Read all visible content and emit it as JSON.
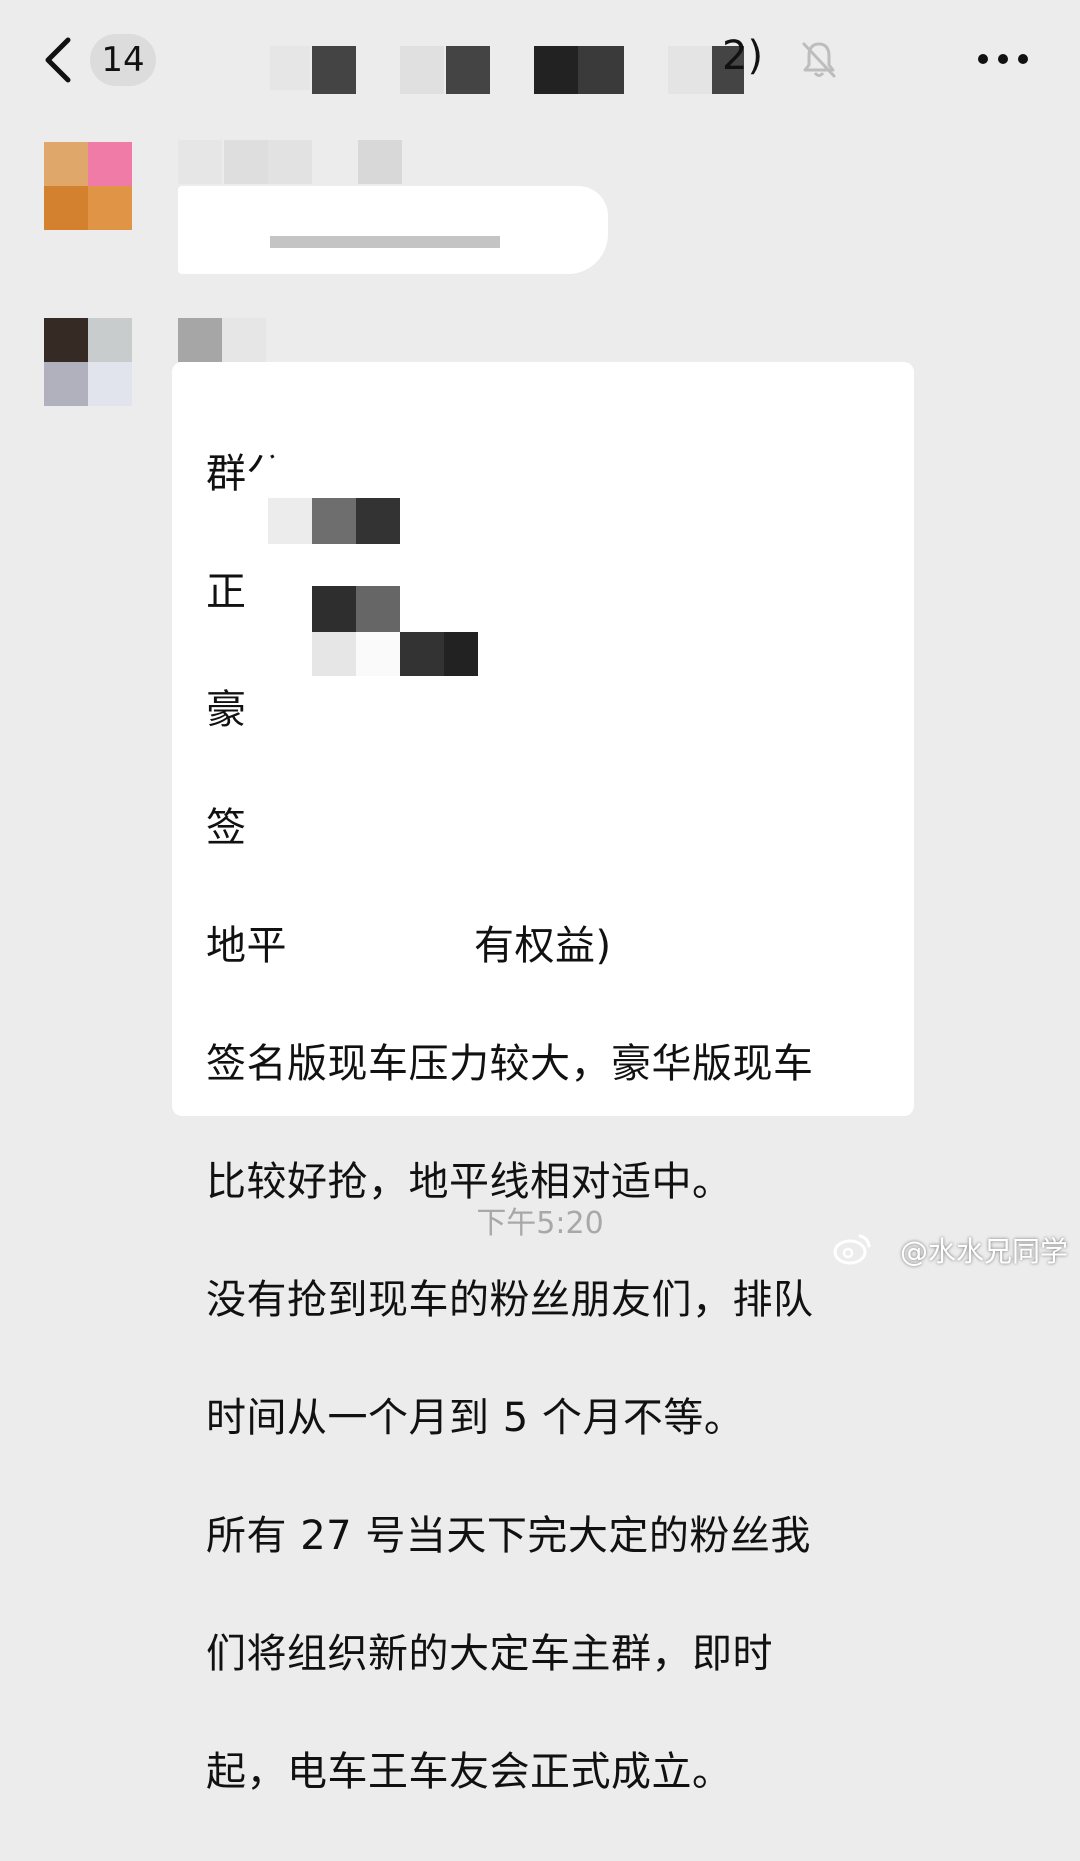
{
  "header": {
    "unread_count": "14",
    "title_visible_tail": "2)",
    "icons": [
      "back-arrow-icon",
      "mute-bell-icon",
      "more-icon"
    ]
  },
  "messages": [
    {
      "type": "blurred",
      "sender": "redacted"
    },
    {
      "type": "announcement",
      "sender": "redacted",
      "lines": [
        "群公告",
        "正",
        "豪",
        "签",
        "地平",
        "有权益)",
        "签名版现车压力较大，豪华版现车",
        "比较好抢，地平线相对适中。",
        "没有抢到现车的粉丝朋友们，排队",
        "时间从一个月到 5 个月不等。",
        "所有 27 号当天下完大定的粉丝我",
        "们将组织新的大定车主群，即时",
        "起，电车王车友会正式成立。"
      ]
    }
  ],
  "timestamp": "下午5:20",
  "watermark": "@水水兄同学"
}
